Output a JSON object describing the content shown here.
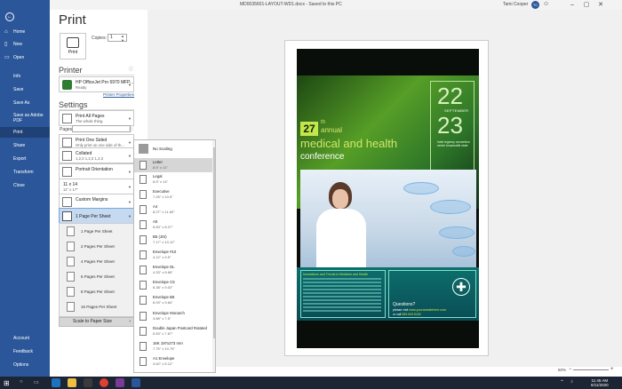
{
  "titlebar": {
    "document": "MD0035601-LAYOUT-WD1.docx  -  Saved to this PC",
    "user": "Tami Cooper",
    "avatar": "TC",
    "minimize": "–",
    "restore": "▢",
    "close": "✕"
  },
  "sidebar": {
    "back": "←",
    "items": [
      {
        "label": "Home",
        "icon": "⌂"
      },
      {
        "label": "New",
        "icon": "▯"
      },
      {
        "label": "Open",
        "icon": "▭"
      },
      {
        "label": "Info"
      },
      {
        "label": "Save"
      },
      {
        "label": "Save As"
      },
      {
        "label": "Save as Adobe PDF"
      },
      {
        "label": "Print"
      },
      {
        "label": "Share"
      },
      {
        "label": "Export"
      },
      {
        "label": "Transform"
      },
      {
        "label": "Close"
      },
      {
        "label": "Account"
      },
      {
        "label": "Feedback"
      },
      {
        "label": "Options"
      }
    ]
  },
  "print": {
    "title": "Print",
    "button": "Print",
    "copies_label": "Copies:",
    "copies_value": "1"
  },
  "printer": {
    "heading": "Printer",
    "name": "HP OfficeJet Pro 6970 MFP...",
    "status": "Ready",
    "properties": "Printer Properties",
    "info": "ⓘ"
  },
  "settings": {
    "heading": "Settings",
    "info": "ⓘ",
    "pages_label": "Pages:",
    "items": [
      {
        "l1": "Print All Pages",
        "l2": "The whole thing"
      },
      {
        "l1": "Print One Sided",
        "l2": "Only print on one side of th..."
      },
      {
        "l1": "Collated",
        "l2": "1,2,3    1,2,3    1,2,3"
      },
      {
        "l1": "Portrait Orientation"
      },
      {
        "l1": "11 x 14",
        "l2": "11\" x 17\""
      },
      {
        "l1": "Custom Margins"
      },
      {
        "l1": "1 Page Per Sheet"
      }
    ],
    "pages_per_sheet": [
      "1 Page Per Sheet",
      "2 Pages Per Sheet",
      "4 Pages Per Sheet",
      "6 Pages Per Sheet",
      "8 Pages Per Sheet",
      "16 Pages Per Sheet"
    ],
    "scale": "Scale to Paper Size"
  },
  "paper_menu": {
    "no_scaling": "No Scaling",
    "items": [
      {
        "name": "Letter",
        "size": "8.5\" x 11\"",
        "selected": true
      },
      {
        "name": "Legal",
        "size": "8.5\" x 14\""
      },
      {
        "name": "Executive",
        "size": "7.25\" x 10.5\""
      },
      {
        "name": "A4",
        "size": "8.27\" x 11.69\""
      },
      {
        "name": "A5",
        "size": "5.83\" x 8.27\""
      },
      {
        "name": "B5 (JIS)",
        "size": "7.17\" x 10.12\""
      },
      {
        "name": "Envelope #10",
        "size": "4.12\" x 9.5\""
      },
      {
        "name": "Envelope DL",
        "size": "4.33\" x 8.66\""
      },
      {
        "name": "Envelope C5",
        "size": "6.38\" x 9.02\""
      },
      {
        "name": "Envelope B5",
        "size": "6.93\" x 9.84\""
      },
      {
        "name": "Envelope Monarch",
        "size": "3.88\" x 7.5\""
      },
      {
        "name": "Double Japan Postcard Rotated",
        "size": "5.83\" x 7.87\""
      },
      {
        "name": "16K 197x273 mm",
        "size": "7.75\" x 10.75\""
      },
      {
        "name": "A1 Envelope",
        "size": "3.62\" x 5.12\""
      }
    ]
  },
  "poster": {
    "day1": "22",
    "month": "SEPTEMBER",
    "day2": "23",
    "venue": "hotel regency convention center brownsville state",
    "number": "27",
    "ordinal": "th",
    "annual": "annual",
    "headline": "medical and health",
    "subheadline": "conference",
    "innovations": "Innovations and Trends in Medicine and Health",
    "questions": "Questions?",
    "visit_prefix": "please visit ",
    "visit_url": "www.yourwebsitehere.com",
    "call_prefix": "or call ",
    "call_number": "555.543.5432"
  },
  "zoom": {
    "value": "60%",
    "minus": "−",
    "plus": "+"
  },
  "taskbar": {
    "start": "⊞",
    "time": "11:45 AM",
    "date": "6/11/2020"
  },
  "colors": {
    "sidebar": "#2b579a",
    "accent": "#c5e64b",
    "teal": "#0c6f6c"
  }
}
